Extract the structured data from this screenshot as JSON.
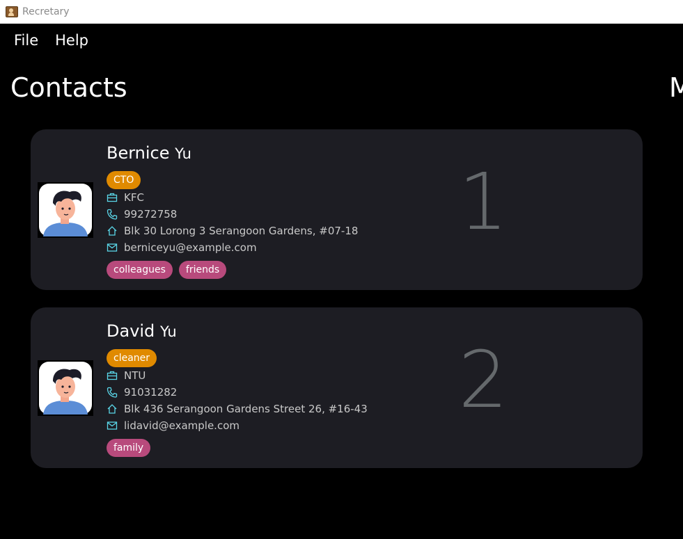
{
  "window": {
    "title": "Recretary"
  },
  "menu": {
    "file": "File",
    "help": "Help"
  },
  "panel": {
    "title": "Contacts",
    "right_title": "M"
  },
  "contacts": [
    {
      "first_name": "Bernice",
      "last_name": "Yu",
      "role": "CTO",
      "company": "KFC",
      "phone": "99272758",
      "address": "Blk 30 Lorong 3 Serangoon Gardens, #07-18",
      "email": "berniceyu@example.com",
      "tags": [
        "colleagues",
        "friends"
      ],
      "index": "1"
    },
    {
      "first_name": "David",
      "last_name": "Yu",
      "role": "cleaner",
      "company": "NTU",
      "phone": "91031282",
      "address": "Blk 436 Serangoon Gardens Street 26, #16-43",
      "email": "lidavid@example.com",
      "tags": [
        "family"
      ],
      "index": "2"
    }
  ],
  "colors": {
    "background": "#000000",
    "card": "#1d1d23",
    "role_tag": "#e08a00",
    "tag": "#b84a7c",
    "icon": "#5ad6e8",
    "index": "#65696c"
  },
  "icons": {
    "company": "briefcase-icon",
    "phone": "phone-icon",
    "address": "home-icon",
    "email": "mail-icon"
  }
}
